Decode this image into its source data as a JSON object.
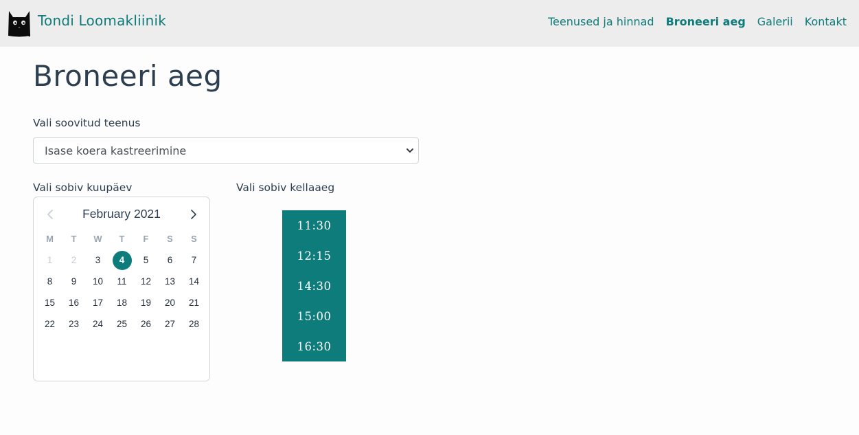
{
  "navbar": {
    "brand": "Tondi Loomakliinik",
    "links": [
      {
        "label": "Teenused ja hinnad",
        "active": false
      },
      {
        "label": "Broneeri aeg",
        "active": true
      },
      {
        "label": "Galerii",
        "active": false
      },
      {
        "label": "Kontakt",
        "active": false
      }
    ]
  },
  "page": {
    "title": "Broneeri aeg"
  },
  "service": {
    "label": "Vali soovitud teenus",
    "selected": "Isase koera kastreerimine"
  },
  "date": {
    "label": "Vali sobiv kuupäev",
    "month": "February 2021",
    "weekdays": [
      "M",
      "T",
      "W",
      "T",
      "F",
      "S",
      "S"
    ],
    "days": [
      "1",
      "2",
      "3",
      "4",
      "5",
      "6",
      "7",
      "8",
      "9",
      "10",
      "11",
      "12",
      "13",
      "14",
      "15",
      "16",
      "17",
      "18",
      "19",
      "20",
      "21",
      "22",
      "23",
      "24",
      "25",
      "26",
      "27",
      "28"
    ],
    "disabled_days": [
      "1",
      "2"
    ],
    "selected_day": "4"
  },
  "time": {
    "label": "Vali sobiv kellaaeg",
    "slots": [
      "11:30",
      "12:15",
      "14:30",
      "15:00",
      "16:30"
    ]
  },
  "colors": {
    "accent": "#0e7c7b",
    "navbar_bg": "#ededed",
    "text": "#2c3e50"
  },
  "icons": {
    "logo": "black-cat-icon",
    "select": "chevron-down-icon",
    "prev": "chevron-left-icon",
    "next": "chevron-right-icon"
  }
}
